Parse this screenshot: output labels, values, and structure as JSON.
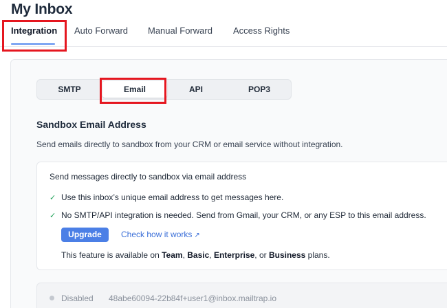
{
  "page": {
    "title": "My Inbox"
  },
  "tabs": [
    {
      "label": "Integration",
      "active": true
    },
    {
      "label": "Auto Forward",
      "active": false
    },
    {
      "label": "Manual Forward",
      "active": false
    },
    {
      "label": "Access Rights",
      "active": false
    }
  ],
  "segmented": [
    {
      "label": "SMTP",
      "active": false
    },
    {
      "label": "Email",
      "active": true
    },
    {
      "label": "API",
      "active": false
    },
    {
      "label": "POP3",
      "active": false
    }
  ],
  "section": {
    "title": "Sandbox Email Address",
    "description": "Send emails directly to sandbox from your CRM or email service without integration."
  },
  "card": {
    "title": "Send messages directly to sandbox via email address",
    "check_icon": "checkmark-icon",
    "checks": [
      "Use this inbox’s unique email address to get messages here.",
      "No SMTP/API integration is needed. Send from Gmail, your CRM, or any ESP to this email address."
    ],
    "upgrade_label": "Upgrade",
    "link_label": "Check how it works",
    "plans": {
      "prefix": "This feature is available on ",
      "plan1": "Team",
      "sep1": ", ",
      "plan2": "Basic",
      "sep2": ", ",
      "plan3": "Enterprise",
      "sep3": ", or ",
      "plan4": "Business",
      "suffix": " plans."
    }
  },
  "status": {
    "label": "Disabled",
    "email": "48abe60094-22b84f+user1@inbox.mailtrap.io"
  },
  "colors": {
    "accent": "#4b7fe6",
    "highlight": "#e5161f",
    "success": "#22a35a"
  }
}
